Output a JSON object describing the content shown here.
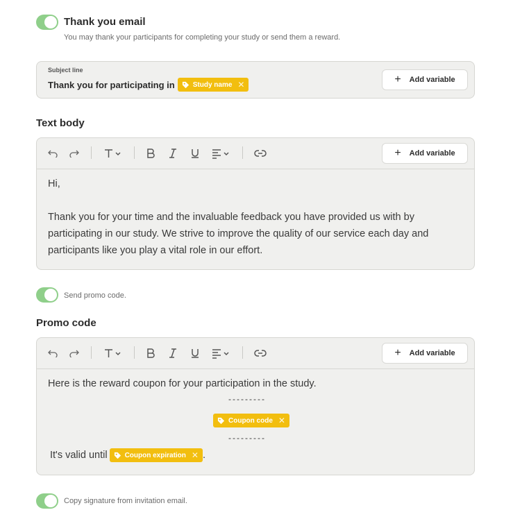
{
  "thank_you": {
    "title": "Thank you email",
    "description": "You may thank your participants for completing your study or send them a reward."
  },
  "subject": {
    "label": "Subject line",
    "text": "Thank you for participating in",
    "chip_label": "Study name",
    "add_variable_label": "Add variable"
  },
  "text_body": {
    "title": "Text body",
    "add_variable_label": "Add variable",
    "greeting": "Hi,",
    "paragraph": "Thank you for your time and the invaluable feedback you have provided us with by participating in our study. We strive to improve the quality of our service each day and participants like you play a vital role in our effort."
  },
  "promo_toggle": {
    "label": "Send promo code."
  },
  "promo_code": {
    "title": "Promo code",
    "add_variable_label": "Add variable",
    "intro": "Here is the reward coupon for your participation in the study.",
    "dashes": "---------",
    "coupon_chip": "Coupon code",
    "valid_prefix": "It's valid until",
    "expiration_chip": "Coupon expiration",
    "valid_suffix": "."
  },
  "signature_toggle": {
    "label": "Copy signature from invitation email."
  },
  "colors": {
    "toggle_on": "#8fcf8a",
    "chip": "#f2be0f",
    "box_bg": "#f0f0ee"
  }
}
